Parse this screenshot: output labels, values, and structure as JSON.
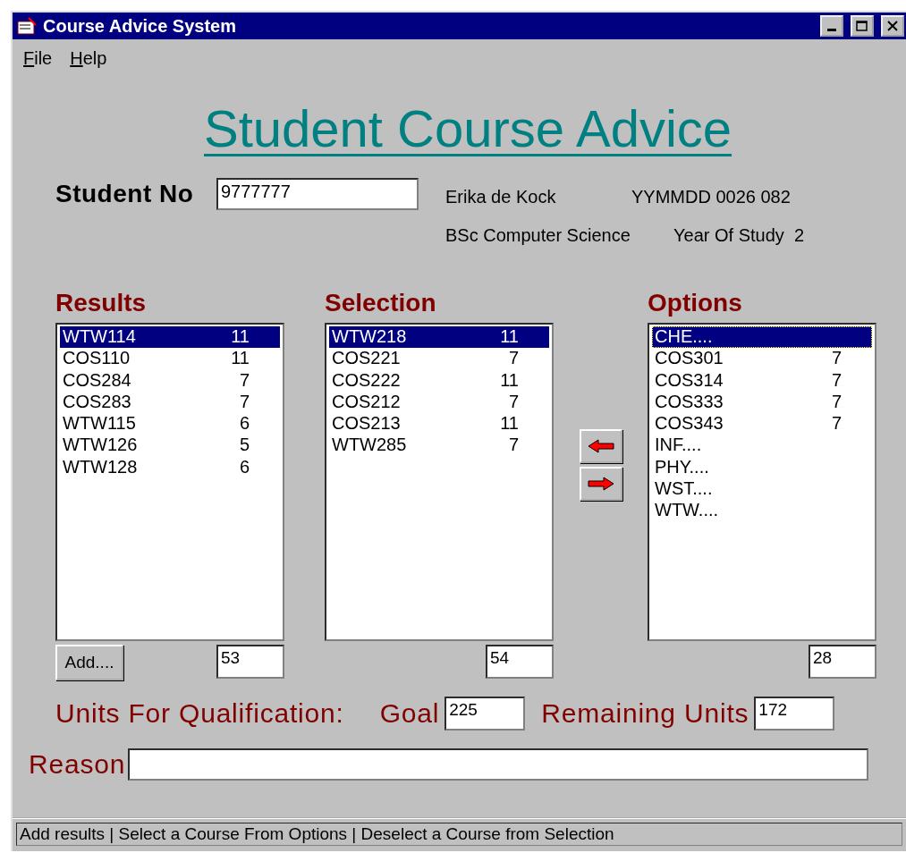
{
  "window": {
    "title": "Course Advice System"
  },
  "menu": [
    {
      "label": "File"
    },
    {
      "label": "Help"
    }
  ],
  "heading": "Student Course Advice",
  "student": {
    "label": "Student No",
    "value": "9777777",
    "name": "Erika de Kock",
    "id_number": "YYMMDD 0026 082",
    "degree": "BSc Computer Science",
    "year_label": "Year Of Study",
    "year": "2"
  },
  "lists": [
    {
      "title": "Results",
      "total": "53",
      "add_button": "Add....",
      "items": [
        {
          "code": "WTW114",
          "units": "11",
          "selected": true
        },
        {
          "code": "COS110",
          "units": "11",
          "selected": false
        },
        {
          "code": "COS284",
          "units": "7",
          "selected": false
        },
        {
          "code": "COS283",
          "units": "7",
          "selected": false
        },
        {
          "code": "WTW115",
          "units": "6",
          "selected": false
        },
        {
          "code": "WTW126",
          "units": "5",
          "selected": false
        },
        {
          "code": "WTW128",
          "units": "6",
          "selected": false
        }
      ]
    },
    {
      "title": "Selection",
      "total": "54",
      "items": [
        {
          "code": "WTW218",
          "units": "11",
          "selected": true
        },
        {
          "code": "COS221",
          "units": "7",
          "selected": false
        },
        {
          "code": "COS222",
          "units": "11",
          "selected": false
        },
        {
          "code": "COS212",
          "units": "7",
          "selected": false
        },
        {
          "code": "COS213",
          "units": "11",
          "selected": false
        },
        {
          "code": "WTW285",
          "units": "7",
          "selected": false
        }
      ]
    },
    {
      "title": "Options",
      "total": "28",
      "items": [
        {
          "code": "CHE....",
          "selected": true
        },
        {
          "code": "COS301",
          "units": "7",
          "selected": false
        },
        {
          "code": "COS314",
          "units": "7",
          "selected": false
        },
        {
          "code": "COS333",
          "units": "7",
          "selected": false
        },
        {
          "code": "COS343",
          "units": "7",
          "selected": false
        },
        {
          "code": "INF....",
          "selected": false
        },
        {
          "code": "PHY....",
          "selected": false
        },
        {
          "code": "WST....",
          "selected": false
        },
        {
          "code": "WTW....",
          "selected": false
        }
      ]
    }
  ],
  "units": {
    "label": "Units For Qualification:",
    "goal_label": "Goal",
    "goal": "225",
    "remaining_label": "Remaining Units",
    "remaining": "172"
  },
  "reason": {
    "label": "Reason"
  },
  "status_bar": "Add results | Select a Course From Options | Deselect a Course from Selection"
}
